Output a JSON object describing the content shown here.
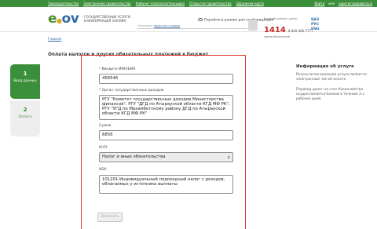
{
  "topbar": {
    "links": [
      "Законодательство",
      "Электронное правительство",
      "Кабинет налогоплательщика",
      "Открытое правительство",
      "Дорожная карта"
    ],
    "login": "Войти",
    "or": "или",
    "register": "зарегистрироваться"
  },
  "header": {
    "logo_e": "e",
    "logo_o": "g",
    "logo_gov": "ov",
    "tagline": "ГОСУДАРСТВЕННЫЕ УСЛУГИ И ИНФОРМАЦИЯ ОНЛАЙН",
    "search_hint_prefix": "Например: ",
    "search_hint_link": "адресная справка",
    "mode_link": "Перейти в режим для слабовидящих",
    "contact_label": "Единый контакт-центр",
    "contact_number": "1414",
    "contact_alt": "8 800 080 7777",
    "contact_free": "звонок бесплатный",
    "langs": [
      "ҚАЗ",
      "РУС",
      "ENG"
    ]
  },
  "breadcrumb": "Главная",
  "page_title": "Оплата налогов и других обязательных платежей в бюджет",
  "steps": [
    {
      "number": "1",
      "label": "Ввод данных"
    },
    {
      "number": "2",
      "label": "Оплата"
    }
  ],
  "form": {
    "iin_label": "* Введите ИИН/БИН",
    "iin_value": "456546",
    "organ_label": "* Орган государственных доходов",
    "organ_value": "РГУ \"Комитет государственных доходов Министерства финансов\", РГУ \"ДГД по Атырауской области КГД МФ РК\", РГУ \"УГД по Махамбетскому району ДГД по Атырауской области КГД МФ РК\"",
    "sum_label": "Сумма",
    "sum_value": "6856",
    "knp_label": "КНП:",
    "knp_value": "Налог и иные обязательства",
    "kbk_label": "КБК:",
    "kbk_value": "101201-Индивидуальный подоходный налог с доходов, облагаемых у источника выплаты",
    "submit_label": "Оплатить"
  },
  "info": {
    "title": "Информация об услуге",
    "p1": "Результатом оказания услуги является электронный чек об оплате.",
    "p2": "Перевод денег на счет Казначейства осуществляется банком в течение 2-х рабочих дней."
  }
}
